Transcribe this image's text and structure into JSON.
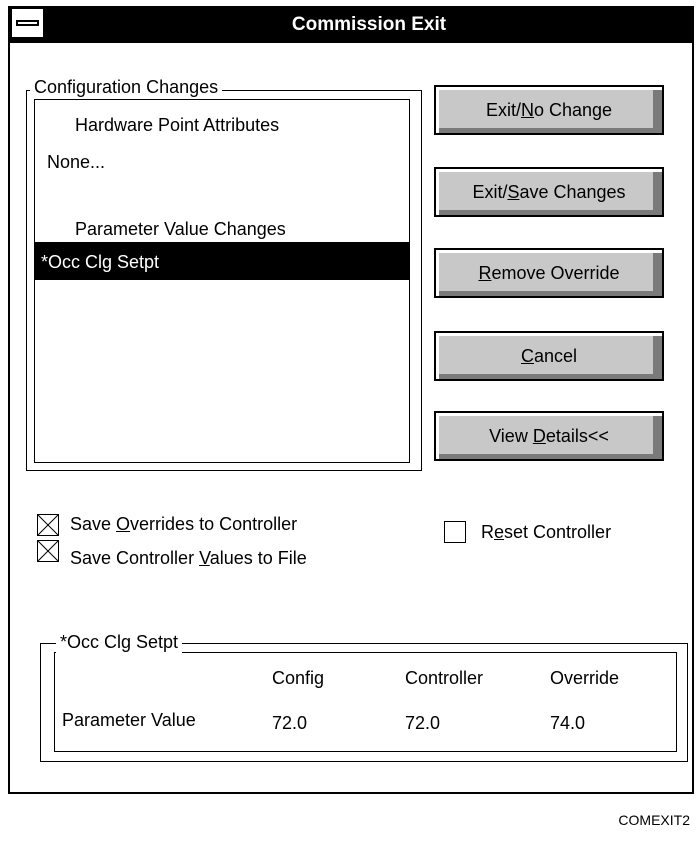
{
  "window": {
    "title": "Commission Exit",
    "caption": "COMEXIT2"
  },
  "config_group": {
    "label": "Configuration Changes",
    "list": {
      "heading_hw": "Hardware Point Attributes",
      "hw_value": "None...",
      "heading_param": "Parameter Value Changes",
      "selected_item": "*Occ Clg Setpt"
    }
  },
  "buttons": {
    "exit_no_change": {
      "pre": "Exit/",
      "key": "N",
      "post": "o Change"
    },
    "exit_save": {
      "pre": "Exit/",
      "key": "S",
      "post": "ave Changes"
    },
    "remove_override": {
      "pre": "",
      "key": "R",
      "post": "emove Override"
    },
    "cancel": {
      "pre": "",
      "key": "C",
      "post": "ancel"
    },
    "view_details": {
      "pre": "View ",
      "key": "D",
      "post": "etails<<"
    }
  },
  "checkboxes": {
    "save_overrides": {
      "pre": "Save ",
      "key": "O",
      "post": "verrides to Controller",
      "checked": true
    },
    "save_values": {
      "pre": "Save Controller ",
      "key": "V",
      "post": "alues to File",
      "checked": true
    },
    "reset_controller": {
      "pre": "R",
      "key": "e",
      "post": "set Controller",
      "checked": false
    }
  },
  "param_group": {
    "label": "*Occ Clg Setpt",
    "headers": [
      "Config",
      "Controller",
      "Override"
    ],
    "row_label": "Parameter Value",
    "values": [
      "72.0",
      "72.0",
      "74.0"
    ]
  }
}
